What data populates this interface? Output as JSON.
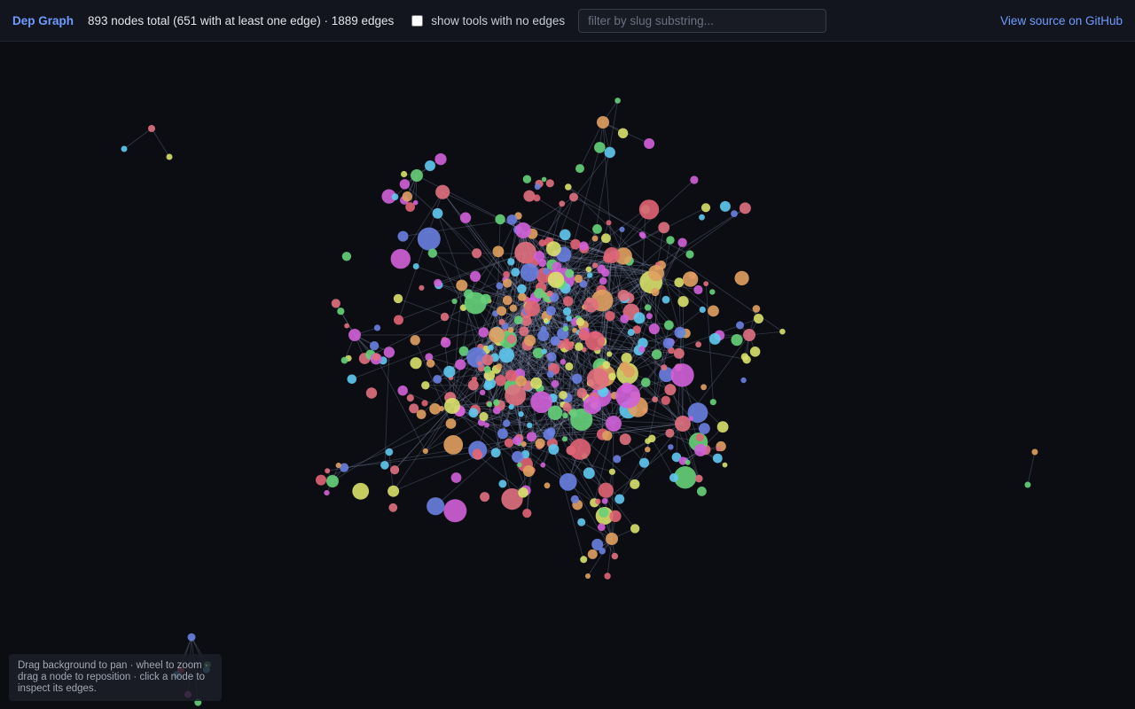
{
  "header": {
    "brand": "Dep Graph",
    "stats": "893 nodes total (651 with at least one edge) · 1889 edges",
    "toggle_label": "show tools with no edges",
    "toggle_checked": false,
    "filter_value": "",
    "filter_placeholder": "filter by slug substring...",
    "github_link": "View source on GitHub"
  },
  "graph": {
    "node_count": 893,
    "nodes_with_edges": 651,
    "edge_count": 1889,
    "background_color": "#0b0d13",
    "edge_color": "#7d8aa8",
    "node_palette": [
      "#e06474",
      "#5fc9f0",
      "#6a7fe0",
      "#e0a060",
      "#66d17a",
      "#d8e06a",
      "#d060d8",
      "#e07080"
    ]
  },
  "hint": {
    "text": "Drag background to pan · wheel to zoom · drag a node to reposition · click a node to inspect its edges."
  }
}
